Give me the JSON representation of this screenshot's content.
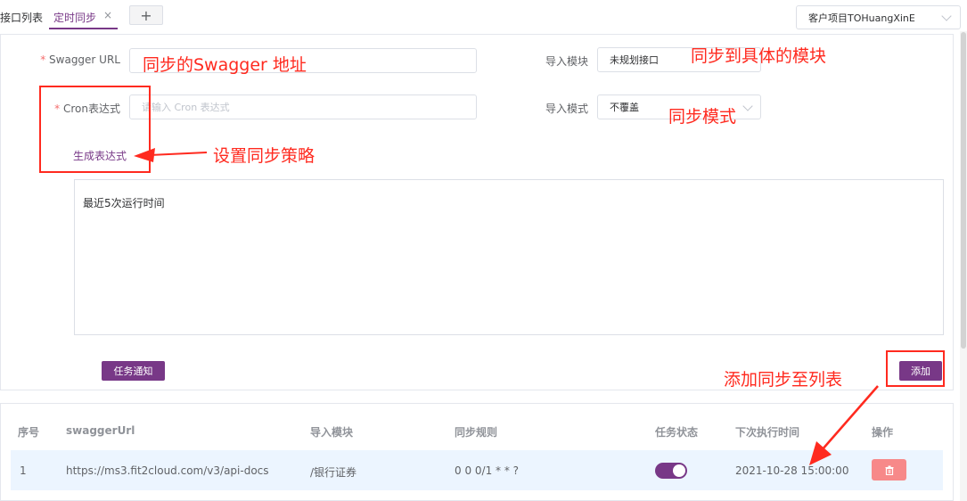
{
  "tabs": [
    {
      "label": "接口列表"
    },
    {
      "label": "定时同步",
      "close": "×"
    }
  ],
  "add_tab_label": "+",
  "project_select": {
    "value": "客户项目TOHuangXinE"
  },
  "form": {
    "swagger_url_label": "Swagger URL",
    "cron_label": "Cron表达式",
    "required_mark": "*",
    "cron_placeholder": "请输入 Cron 表达式",
    "import_module_label": "导入模块",
    "import_module_value": "未规划接口",
    "import_mode_label": "导入模式",
    "import_mode_value": "不覆盖",
    "generate_link": "生成表达式",
    "recent_runs_label": "最近5次运行时间",
    "notify_button": "任务通知",
    "add_button": "添加"
  },
  "annotations": {
    "swagger": "同步的Swagger 地址",
    "module": "同步到具体的模块",
    "mode": "同步模式",
    "strategy": "设置同步策略",
    "add_to_list": "添加同步至列表"
  },
  "table": {
    "headers": [
      "序号",
      "swaggerUrl",
      "导入模块",
      "同步规则",
      "任务状态",
      "下次执行时间",
      "操作"
    ],
    "rows": [
      {
        "index": "1",
        "url": "https://ms3.fit2cloud.com/v3/api-docs",
        "module": "/银行证券",
        "rule": "0 0 0/1 * * ?",
        "status_on": true,
        "next_time": "2021-10-28 15:00:00"
      }
    ]
  },
  "colors": {
    "brand": "#783887",
    "annotation": "#ff2a1f",
    "danger": "#f78989"
  }
}
